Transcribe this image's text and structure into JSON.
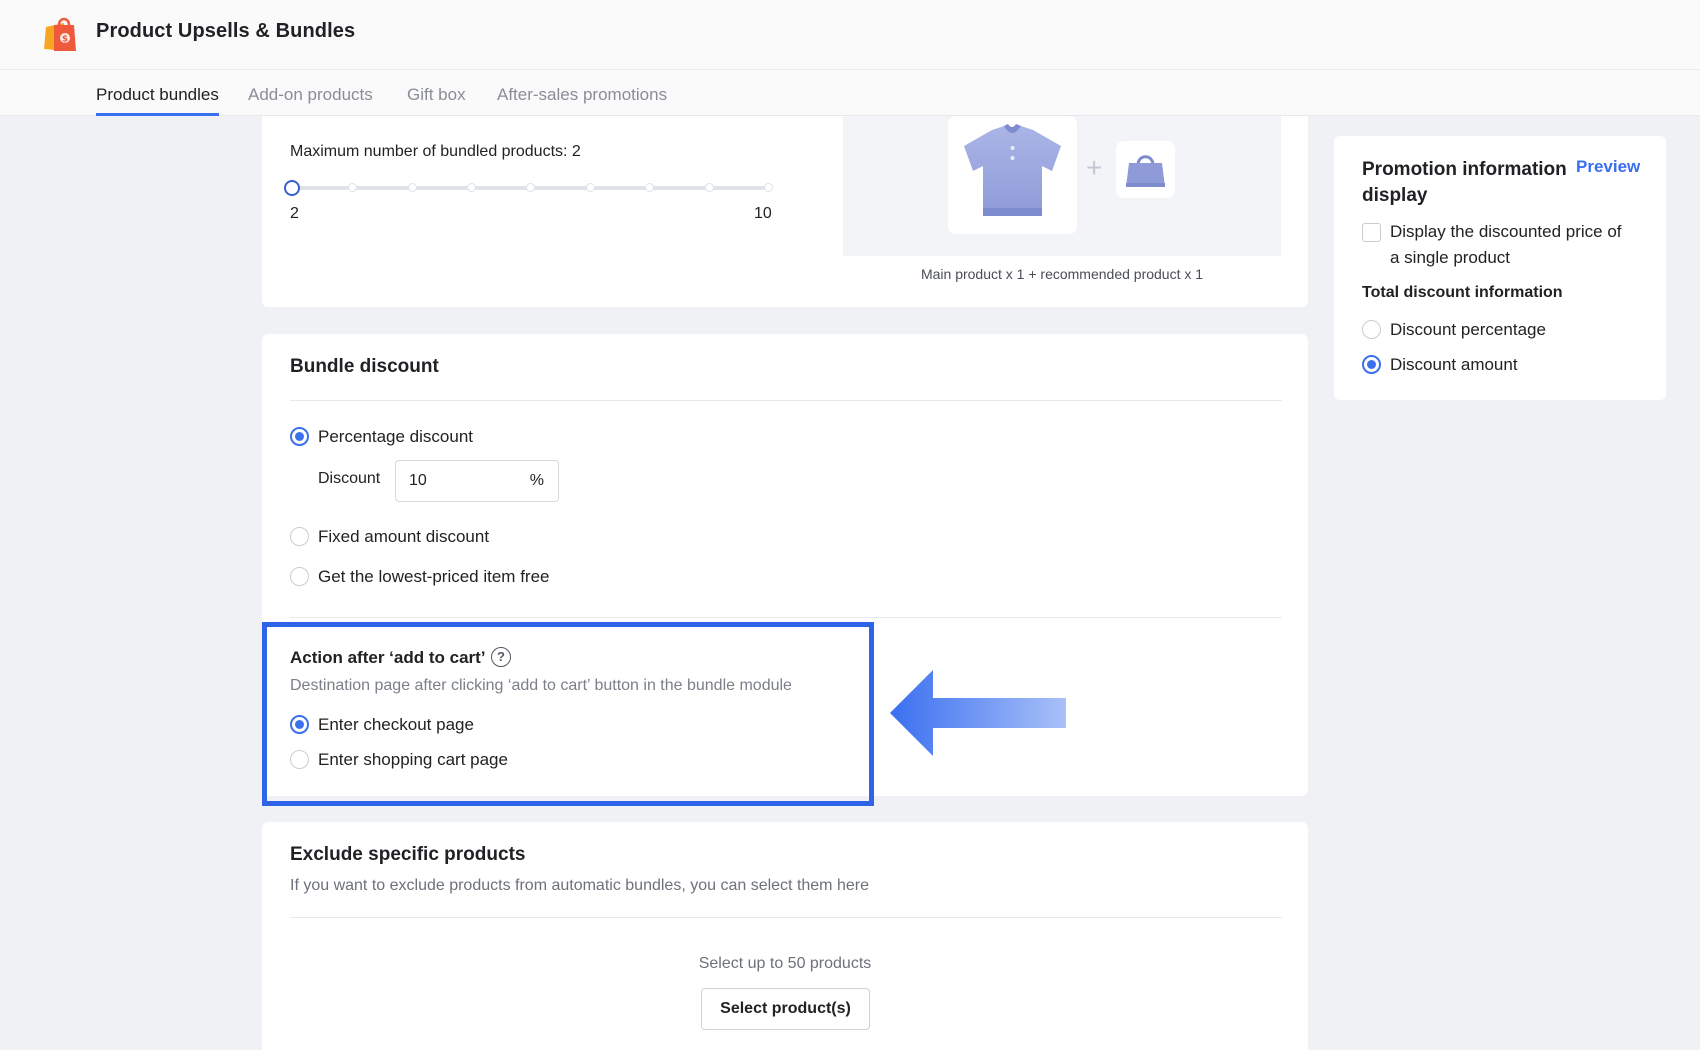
{
  "app": {
    "title": "Product Upsells & Bundles"
  },
  "tabs": [
    {
      "label": "Product bundles",
      "active": true
    },
    {
      "label": "Add-on products",
      "active": false
    },
    {
      "label": "Gift box",
      "active": false
    },
    {
      "label": "After-sales promotions",
      "active": false
    }
  ],
  "bundle_size": {
    "label": "Maximum number of bundled products: 2",
    "value": 2,
    "min_label": "2",
    "max_label": "10",
    "preview_caption": "Main product x 1 + recommended product x 1"
  },
  "bundle_discount": {
    "title": "Bundle discount",
    "options": {
      "percentage": "Percentage discount",
      "fixed": "Fixed amount discount",
      "lowest_free": "Get the lowest-priced item free"
    },
    "selected": "percentage",
    "discount_label": "Discount",
    "discount_value": "10",
    "discount_unit": "%"
  },
  "action_after_cart": {
    "title": "Action after ‘add to cart’",
    "help_icon": "question-circle-icon",
    "description": "Destination page after clicking ‘add to cart’ button in the bundle module",
    "options": {
      "checkout": "Enter checkout page",
      "cart": "Enter shopping cart page"
    },
    "selected": "checkout"
  },
  "exclude": {
    "title": "Exclude specific products",
    "description": "If you want to exclude products from automatic bundles, you can select them here",
    "limit_text": "Select up to 50 products",
    "button_label": "Select product(s)"
  },
  "promotion_display": {
    "title": "Promotion information display",
    "preview_link": "Preview",
    "single_price_checkbox": "Display the discounted price of a single product",
    "single_price_checked": false,
    "total_label": "Total discount information",
    "options": {
      "percentage": "Discount percentage",
      "amount": "Discount amount"
    },
    "selected": "amount"
  },
  "colors": {
    "accent": "#3a6ff0",
    "highlight_border": "#2f63e8",
    "page_background": "#f0f1f4"
  }
}
